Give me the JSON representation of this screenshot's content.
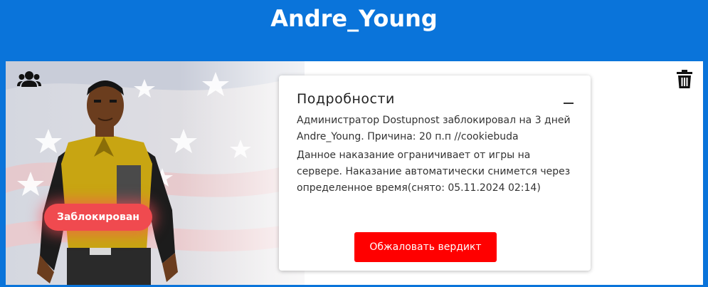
{
  "header": {
    "player_name": "Andre_Young"
  },
  "profile": {
    "status_badge": "Заблокирован",
    "friends_icon": "users-icon",
    "delete_icon": "trash-icon"
  },
  "details": {
    "title": "Подробности",
    "collapse_icon": "minus-icon",
    "ban_message_lines": [
      "Администратор Dostupnost заблокировал на 3 дней",
      "Andre_Young. Причина: 20 п.п //cookiebuda"
    ],
    "info_lines": [
      "Данное наказание ограничивает от игры на",
      "сервере. Наказание автоматически снимется через",
      "определенное время(снято: 05.11.2024 02:14)"
    ],
    "appeal_button": "Обжаловать вердикт"
  },
  "colors": {
    "header_bg": "#0a74da",
    "badge_bg": "#f04a4f",
    "appeal_button_bg": "#ff0000"
  }
}
